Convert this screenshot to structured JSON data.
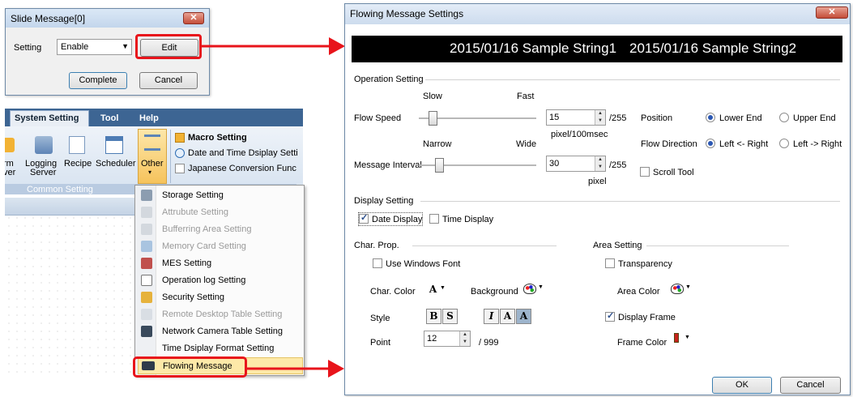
{
  "slide_dialog": {
    "title": "Slide Message[0]",
    "close_glyph": "✕",
    "setting_label": "Setting",
    "setting_value": "Enable",
    "edit_label": "Edit",
    "complete_label": "Complete",
    "cancel_label": "Cancel"
  },
  "ribbon": {
    "tabs": [
      "System Setting",
      "Tool",
      "Help"
    ],
    "buttons": [
      {
        "label_top": "rm",
        "label_bottom": "ver",
        "icon": "alarm-server-icon"
      },
      {
        "label_top": "Logging",
        "label_bottom": "Server",
        "icon": "logging-server-icon"
      },
      {
        "label_top": "Recipe",
        "label_bottom": "",
        "icon": "recipe-icon"
      },
      {
        "label_top": "Scheduler",
        "label_bottom": "",
        "icon": "scheduler-icon"
      },
      {
        "label_top": "Other",
        "label_bottom": "▾",
        "icon": "other-icon"
      }
    ],
    "group_label": "Common Setting",
    "right_items": [
      "Macro Setting",
      "Date and Time Dsiplay Setti",
      "Japanese Conversion Func"
    ]
  },
  "menu": {
    "items": [
      {
        "label": "Storage Setting",
        "enabled": true
      },
      {
        "label": "Attrubute Setting",
        "enabled": false
      },
      {
        "label": "Bufferring Area Setting",
        "enabled": false
      },
      {
        "label": "Memory Card Setting",
        "enabled": false
      },
      {
        "label": "MES Setting",
        "enabled": true
      },
      {
        "label": "Operation log Setting",
        "enabled": true
      },
      {
        "label": "Security Setting",
        "enabled": true
      },
      {
        "label": "Remote Desktop Table Setting",
        "enabled": false
      },
      {
        "label": "Network Camera Table Setting",
        "enabled": true
      },
      {
        "label": "Time Dsiplay Format Setting",
        "enabled": true
      },
      {
        "label": "Flowing Message",
        "enabled": true,
        "highlighted": true
      }
    ]
  },
  "flow_dialog": {
    "title": "Flowing Message Settings",
    "close_glyph": "✕",
    "preview_text1": "2015/01/16 Sample String1",
    "preview_text2": "2015/01/16 Sample String2",
    "operation_setting": "Operation Setting",
    "slow": "Slow",
    "fast": "Fast",
    "flow_speed": "Flow Speed",
    "flow_speed_value": "15",
    "flow_speed_max": "/255",
    "flow_speed_unit": "pixel/100msec",
    "position": "Position",
    "lower_end": "Lower End",
    "upper_end": "Upper End",
    "narrow": "Narrow",
    "wide": "Wide",
    "flow_direction": "Flow Direction",
    "left_from_right": "Left <- Right",
    "left_to_right": "Left -> Right",
    "message_interval": "Message Interval",
    "message_interval_value": "30",
    "message_interval_max": "/255",
    "message_interval_unit": "pixel",
    "scroll_tool": "Scroll Tool",
    "display_setting": "Display Setting",
    "date_display": "Date Display",
    "time_display": "Time Display",
    "char_prop": "Char. Prop.",
    "area_setting": "Area Setting",
    "use_windows_font": "Use Windows Font",
    "transparency": "Transparency",
    "char_color": "Char. Color",
    "background": "Background",
    "area_color": "Area Color",
    "style": "Style",
    "display_frame": "Display Frame",
    "point": "Point",
    "point_value": "12",
    "point_max": "/ 999",
    "frame_color": "Frame Color",
    "ok": "OK",
    "cancel": "Cancel",
    "glyph_a": "A",
    "glyph_b": "B",
    "glyph_s": "S",
    "glyph_i": "I"
  },
  "colors": {
    "highlight_red": "#e8141b",
    "preview_bg": "#000000",
    "preview_fg": "#ffffff",
    "ribbon_tab_blue": "#2e5d9a"
  }
}
